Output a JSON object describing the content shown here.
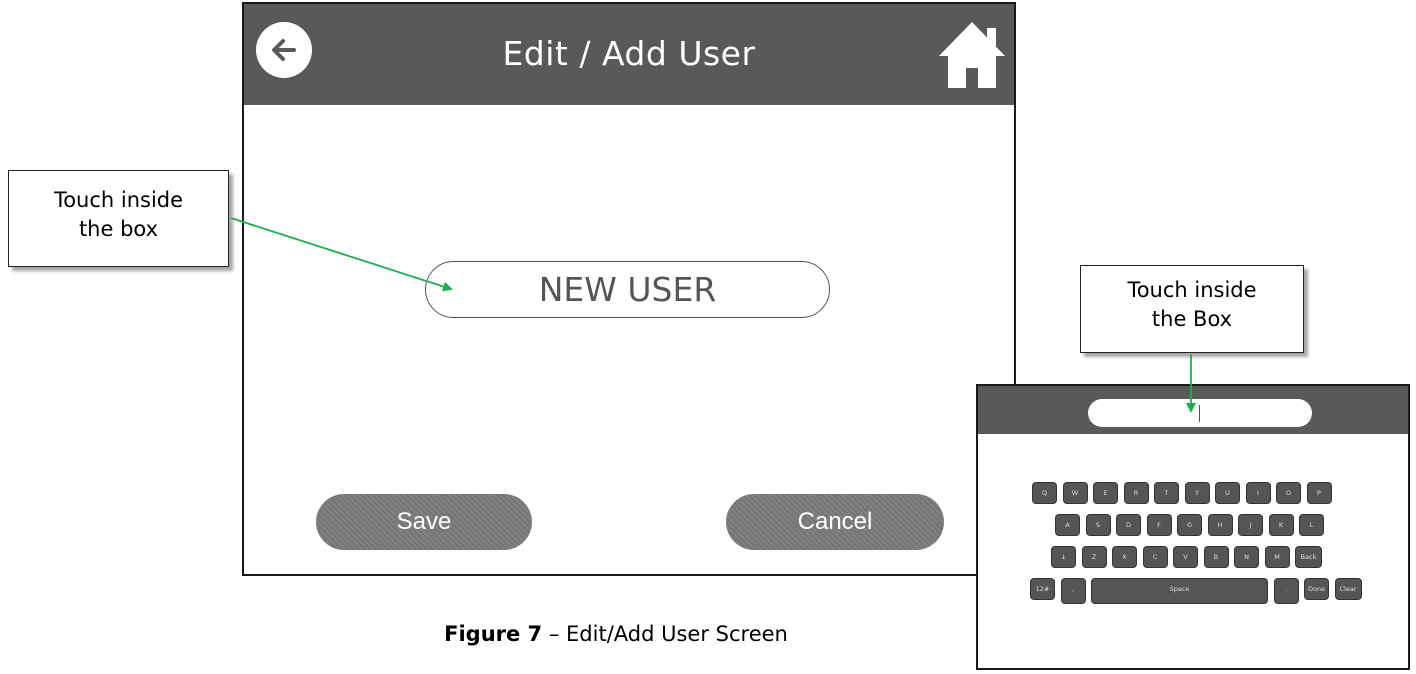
{
  "screen": {
    "title": "Edit / Add User",
    "name_value": "NEW USER",
    "save_label": "Save",
    "cancel_label": "Cancel",
    "colors": {
      "titlebar": "#595959",
      "button": "#7a7a7a"
    }
  },
  "callouts": {
    "first": [
      "Touch inside",
      "the box"
    ],
    "second": [
      "Touch inside",
      "the Box"
    ],
    "arrow_color": "#1ab04a"
  },
  "keyboard": {
    "input_value": "",
    "rows": [
      [
        "Q",
        "W",
        "E",
        "R",
        "T",
        "Y",
        "U",
        "I",
        "O",
        "P"
      ],
      [
        "A",
        "S",
        "D",
        "F",
        "G",
        "H",
        "J",
        "K",
        "L"
      ],
      [
        "↓",
        "Z",
        "X",
        "C",
        "V",
        "B",
        "N",
        "M",
        "Back"
      ],
      [
        "12#",
        ",",
        "Space",
        ".",
        "Done",
        "Clear"
      ]
    ]
  },
  "caption": {
    "figure": "Figure 7",
    "text": " – Edit/Add User Screen"
  }
}
